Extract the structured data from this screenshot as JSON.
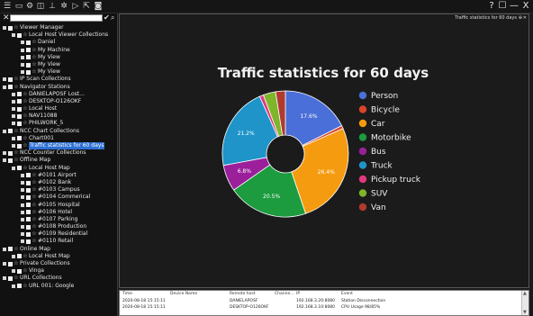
{
  "toolbar": {
    "icons": [
      "menu-icon",
      "monitor-icon",
      "gear-icon",
      "layout-icon",
      "network-icon",
      "settings-icon",
      "play-icon",
      "export-icon",
      "camera-icon"
    ],
    "window_buttons": [
      "?",
      "☐",
      "—",
      "X"
    ]
  },
  "tree": {
    "filter_value": "",
    "nodes": [
      {
        "level": 0,
        "label": "Viewer Manager"
      },
      {
        "level": 1,
        "label": "Local Host Viewer Collections"
      },
      {
        "level": 2,
        "label": "Daniel"
      },
      {
        "level": 2,
        "label": "My Machine"
      },
      {
        "level": 2,
        "label": "My View"
      },
      {
        "level": 2,
        "label": "My View"
      },
      {
        "level": 2,
        "label": "My View"
      },
      {
        "level": 0,
        "label": "IP Scan Collections"
      },
      {
        "level": 0,
        "label": "Navigator Stations"
      },
      {
        "level": 1,
        "label": "DANIELAPOSF Lost..."
      },
      {
        "level": 1,
        "label": "DESKTOP-O126OKF"
      },
      {
        "level": 1,
        "label": "Local Host"
      },
      {
        "level": 1,
        "label": "NAV11088"
      },
      {
        "level": 1,
        "label": "PHILWORK_5"
      },
      {
        "level": 0,
        "label": "NCC Chart Collections"
      },
      {
        "level": 1,
        "label": "Chart001"
      },
      {
        "level": 1,
        "label": "Traffic statistics for 60 days",
        "selected": true
      },
      {
        "level": 0,
        "label": "NCC Counter Collections"
      },
      {
        "level": 0,
        "label": "Offline Map"
      },
      {
        "level": 1,
        "label": "Local Host Map"
      },
      {
        "level": 2,
        "label": "#0101 Airport"
      },
      {
        "level": 2,
        "label": "#0102 Bank"
      },
      {
        "level": 2,
        "label": "#0103 Campus"
      },
      {
        "level": 2,
        "label": "#0104 Commerical"
      },
      {
        "level": 2,
        "label": "#0105 Hospital"
      },
      {
        "level": 2,
        "label": "#0106 Hotel"
      },
      {
        "level": 2,
        "label": "#0107 Parking"
      },
      {
        "level": 2,
        "label": "#0108 Production"
      },
      {
        "level": 2,
        "label": "#0109 Residential"
      },
      {
        "level": 2,
        "label": "#0110 Retail"
      },
      {
        "level": 0,
        "label": "Online Map"
      },
      {
        "level": 1,
        "label": "Local Host Map"
      },
      {
        "level": 0,
        "label": "Private Collections"
      },
      {
        "level": 1,
        "label": "Vinga"
      },
      {
        "level": 0,
        "label": "URL Collections"
      },
      {
        "level": 1,
        "label": "URL 001: Google"
      }
    ]
  },
  "main_panel": {
    "title": "Traffic statistics for 60 days"
  },
  "chart_data": {
    "type": "pie",
    "title": "Traffic statistics for 60 days",
    "slices": [
      {
        "label": "Person",
        "value": 17.6,
        "color": "#4b6fd8",
        "shown_label": "17.6%"
      },
      {
        "label": "Bicycle",
        "value": 0.8,
        "color": "#d9452b",
        "shown_label": ""
      },
      {
        "label": "Car",
        "value": 26.4,
        "color": "#f59b0f",
        "shown_label": "26.4%"
      },
      {
        "label": "Motorbike",
        "value": 20.5,
        "color": "#1c9b3f",
        "shown_label": "20.5%"
      },
      {
        "label": "Bus",
        "value": 6.8,
        "color": "#9b1f9b",
        "shown_label": "6.8%"
      },
      {
        "label": "Truck",
        "value": 21.2,
        "color": "#1e94c9",
        "shown_label": "21.2%"
      },
      {
        "label": "Pickup truck",
        "value": 1.0,
        "color": "#e0397f",
        "shown_label": ""
      },
      {
        "label": "SUV",
        "value": 3.2,
        "color": "#7fb52b",
        "shown_label": ""
      },
      {
        "label": "Van",
        "value": 2.5,
        "color": "#b03a2e",
        "shown_label": ""
      }
    ],
    "legend_position": "right",
    "donut": true
  },
  "log": {
    "columns": [
      "Time",
      "Device Name",
      "Remote host",
      "Channe...",
      "IP",
      "Event"
    ],
    "rows": [
      [
        "2020-08-18 15:15:11",
        "",
        "DANIELAPOSF",
        "",
        "192.168.3.20:8080",
        "Station Disconnection"
      ],
      [
        "2020-08-18 15:15:11",
        "",
        "DESKTOP-O126OKF",
        "",
        "192.168.3.10:8080",
        "CPU Usage 98/85%"
      ]
    ]
  }
}
